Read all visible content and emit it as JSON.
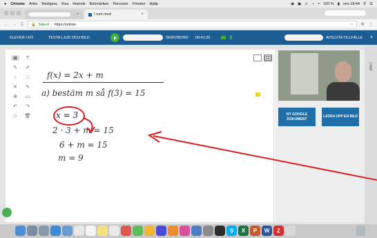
{
  "menubar": {
    "apple": "",
    "items": [
      "Chrome",
      "Arkiv",
      "Redigera",
      "Visa",
      "Historik",
      "Bokmärken",
      "Personer",
      "Fönster",
      "Hjälp"
    ],
    "battery": "100 %",
    "datetime": "ons 18:44"
  },
  "browser": {
    "active_tab": "I rum med",
    "close_glyph": "×",
    "url_secure": "Säkert",
    "url": "https://online.",
    "back": "←",
    "forward": "→",
    "reload": "C",
    "star": "☆"
  },
  "app_header": {
    "student_queue": "ELEVER I KÖ",
    "test_audio": "TESTA LJUD OCH BILD",
    "desk_label": "SKRIVBORD:",
    "timer": "00:41:26",
    "end_session": "AVSLUTA TILLFÄLLE",
    "close_glyph": "×"
  },
  "whiteboard": {
    "line1": "f(x) = 2x + m",
    "line2": "a) bestäm m så f(3) = 15",
    "line3": "x = 3",
    "line4": "2 · 3 + m = 15",
    "line5": "6 + m = 15",
    "line6": "m = 9",
    "tools": [
      [
        "▣",
        "T"
      ],
      [
        "✎",
        "✐"
      ],
      [
        "○",
        "□"
      ],
      [
        "✕",
        "✎"
      ],
      [
        "⊕",
        "▭"
      ],
      [
        "↶",
        "↷"
      ],
      [
        "◇",
        "🗑"
      ]
    ]
  },
  "side_panel": {
    "btn_google_doc": "NY GOOGLE DOKUMENT",
    "btn_upload": "LADDA UPP EN BILD",
    "chat_label": "CHAT"
  },
  "colors": {
    "header": "#1d5d93",
    "button": "#1f6ea8",
    "play": "#3fae3f",
    "ink_red": "#d62020",
    "ink_dark": "#333333"
  }
}
